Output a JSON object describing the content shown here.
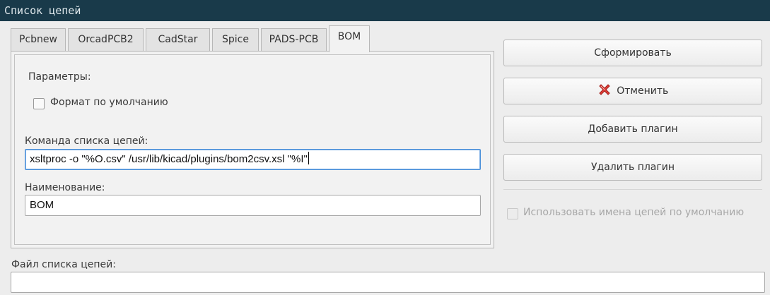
{
  "window": {
    "title": "Список цепей"
  },
  "tabs": [
    {
      "label": "Pcbnew",
      "active": false
    },
    {
      "label": "OrcadPCB2",
      "active": false
    },
    {
      "label": "CadStar",
      "active": false
    },
    {
      "label": "Spice",
      "active": false
    },
    {
      "label": "PADS-PCB",
      "active": false
    },
    {
      "label": "BOM",
      "active": true
    }
  ],
  "panel": {
    "params_label": "Параметры:",
    "default_format_label": "Формат по умолчанию",
    "default_format_checked": false,
    "command_label": "Команда списка цепей:",
    "command_value": "xsltproc -o \"%O.csv\" /usr/lib/kicad/plugins/bom2csv.xsl \"%I\"",
    "name_label": "Наименование:",
    "name_value": "BOM"
  },
  "buttons": {
    "generate": "Сформировать",
    "cancel": "Отменить",
    "cancel_icon": "cancel-x-icon",
    "add_plugin": "Добавить плагин",
    "remove_plugin": "Удалить плагин"
  },
  "options": {
    "use_default_net_names_label": "Использовать имена цепей по умолчанию",
    "use_default_net_names_checked": false,
    "use_default_net_names_enabled": false
  },
  "output": {
    "file_label": "Файл списка цепей:",
    "file_value": ""
  },
  "colors": {
    "titlebar": "#193a4a",
    "background": "#ededed",
    "cancel_icon": "#e0403a"
  }
}
